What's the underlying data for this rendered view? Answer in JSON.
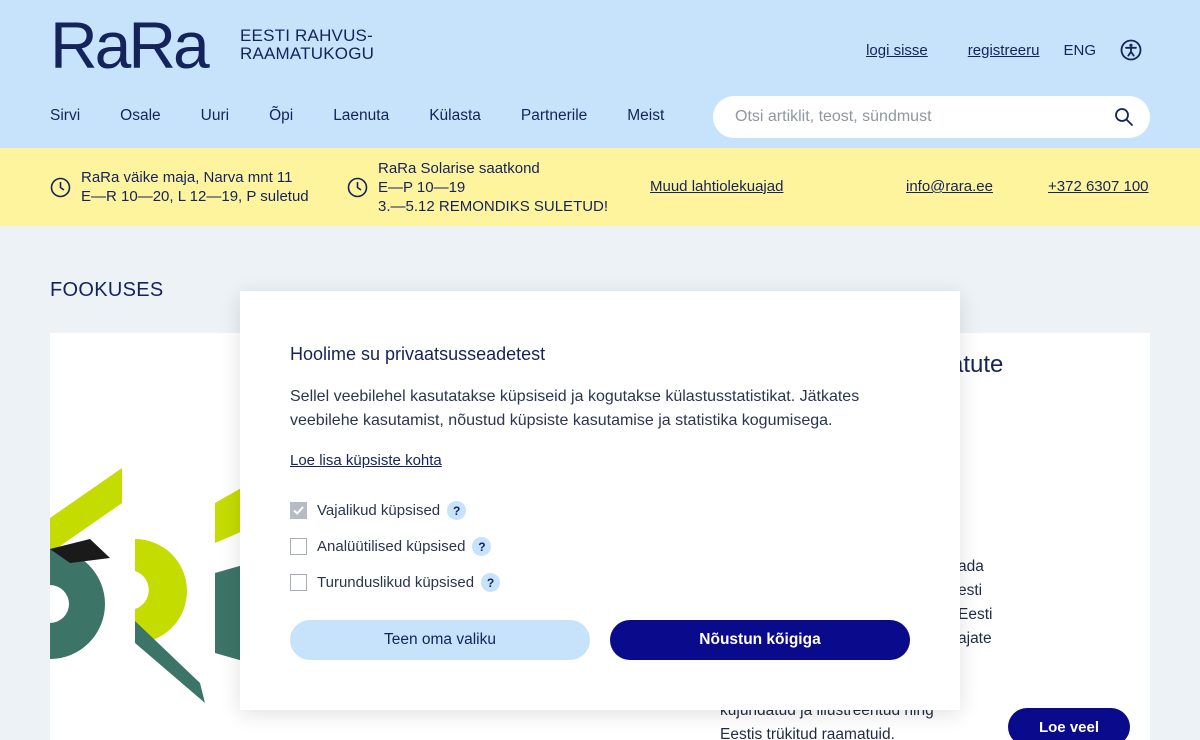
{
  "header": {
    "logo_mark": "RaRa",
    "logo_line1": "EESTI RAHVUS-",
    "logo_line2": "RAAMATUKOGU",
    "login": "logi sisse",
    "register": "registreeru",
    "language": "ENG",
    "accessibility_icon": "accessibility-icon"
  },
  "nav": {
    "items": [
      "Sirvi",
      "Osale",
      "Uuri",
      "Õpi",
      "Laenuta",
      "Külasta",
      "Partnerile",
      "Meist"
    ]
  },
  "search": {
    "placeholder": "Otsi artiklit, teost, sündmust",
    "icon": "search-icon"
  },
  "infobar": {
    "location1": {
      "line1": "RaRa väike maja, Narva mnt 11",
      "line2": "E—R 10—20, L 12—19, P suletud"
    },
    "location2": {
      "line1": "RaRa Solarise saatkond",
      "line2": "E—P 10—19",
      "line3": "3.—5.12 REMONDIKS SULETUD!"
    },
    "other_hours": "Muud lahtiolekuajad",
    "email": "info@rara.ee",
    "phone": "+372 6307 100"
  },
  "focus": {
    "title": "FOOKUSES",
    "card_title_fragment": "matute",
    "card_text_fragments": [
      "ada",
      "esti",
      "Eesti",
      "ajate",
      "kujundatud ja illustreeritud ning",
      "Eestis trükitud raamatuid."
    ],
    "read_more": "Loe veel"
  },
  "cookie_modal": {
    "title": "Hoolime su privaatsusseadetest",
    "description": "Sellel veebilehel kasutatakse küpsiseid ja kogutakse külastusstatistikat. Jätkates veebilehe kasutamist, nõustud küpsiste kasutamise ja statistika kogumisega.",
    "link": "Loe lisa küpsiste kohta",
    "options": [
      {
        "label": "Vajalikud küpsised",
        "checked": true,
        "help": "?"
      },
      {
        "label": "Analüütilised küpsised",
        "checked": false,
        "help": "?"
      },
      {
        "label": "Turunduslikud küpsised",
        "checked": false,
        "help": "?"
      }
    ],
    "button_custom": "Teen oma valiku",
    "button_accept": "Nõustun kõigiga"
  },
  "colors": {
    "header_bg": "#c6e3fb",
    "infobar_bg": "#fef49e",
    "primary": "#0a0a8c",
    "text_dark": "#14235a"
  }
}
